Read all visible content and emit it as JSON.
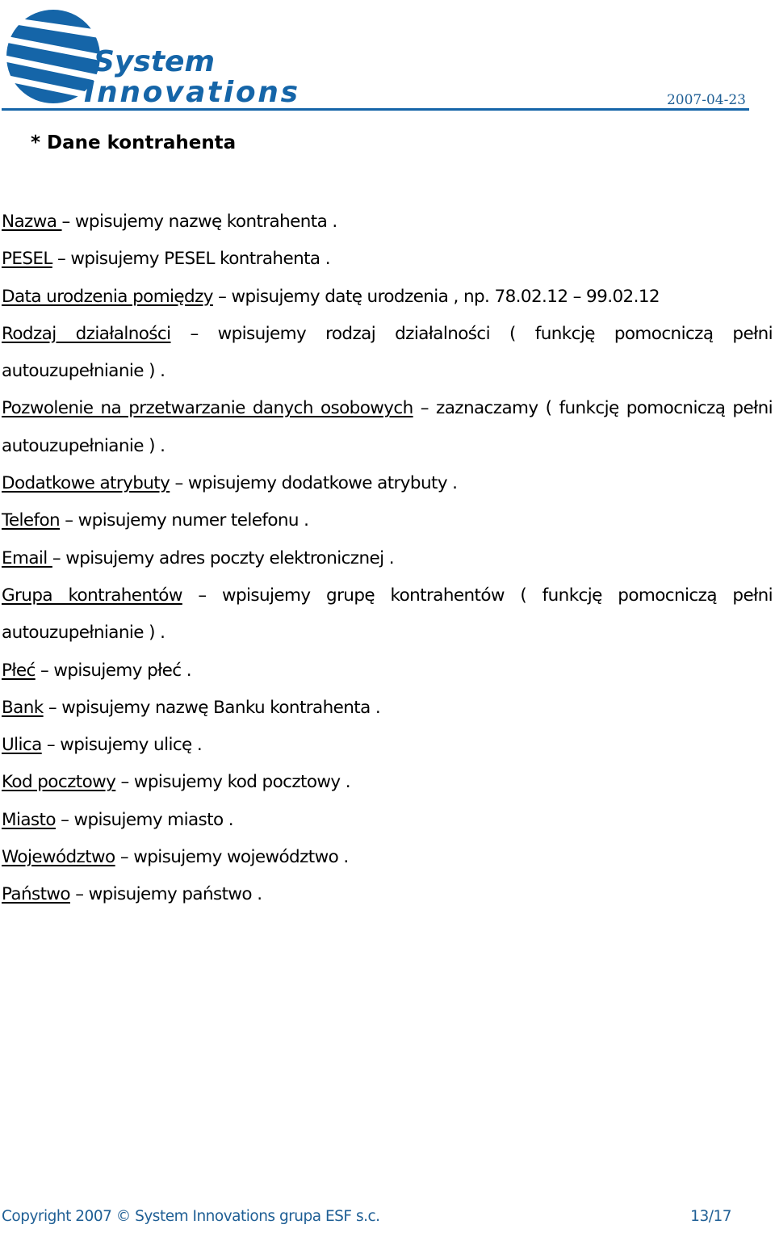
{
  "header": {
    "logo": {
      "line1": "System",
      "line2": "Innovations",
      "icon": "globe-stripes-icon",
      "color": "#1565a8"
    },
    "date": "2007-04-23"
  },
  "section_title": "* Dane kontrahenta",
  "fields": [
    {
      "term": "Nazwa ",
      "description": "– wpisujemy nazwę kontrahenta ."
    },
    {
      "term": "PESEL",
      "description": " – wpisujemy PESEL kontrahenta ."
    },
    {
      "term": "Data urodzenia pomiędzy",
      "description": " – wpisujemy datę urodzenia , np. 78.02.12 – 99.02.12"
    },
    {
      "term": "Rodzaj działalności",
      "description": " – wpisujemy rodzaj działalności ( funkcję pomocniczą pełni autouzupełnianie ) ."
    },
    {
      "term": "Pozwolenie na przetwarzanie danych osobowych",
      "description": " – zaznaczamy ( funkcję pomocniczą pełni autouzupełnianie ) ."
    },
    {
      "term": "Dodatkowe atrybuty",
      "description": " – wpisujemy dodatkowe atrybuty ."
    },
    {
      "term": "Telefon",
      "description": " – wpisujemy numer telefonu ."
    },
    {
      "term": "Email ",
      "description": "– wpisujemy adres poczty elektronicznej ."
    },
    {
      "term": "Grupa kontrahentów",
      "description": " – wpisujemy grupę kontrahentów ( funkcję pomocniczą pełni autouzupełnianie ) ."
    },
    {
      "term": "Płeć",
      "description": " – wpisujemy płeć ."
    },
    {
      "term": "Bank",
      "description": " – wpisujemy nazwę Banku kontrahenta ."
    },
    {
      "term": "Ulica",
      "description": " – wpisujemy ulicę ."
    },
    {
      "term": "Kod pocztowy",
      "description": " – wpisujemy kod pocztowy ."
    },
    {
      "term": "Miasto",
      "description": " – wpisujemy miasto ."
    },
    {
      "term": "Województwo",
      "description": " – wpisujemy województwo ."
    },
    {
      "term": "Państwo",
      "description": " – wpisujemy państwo ."
    }
  ],
  "footer": {
    "copyright": "Copyright 2007 © System Innovations grupa ESF s.c.",
    "page": "13/17"
  }
}
